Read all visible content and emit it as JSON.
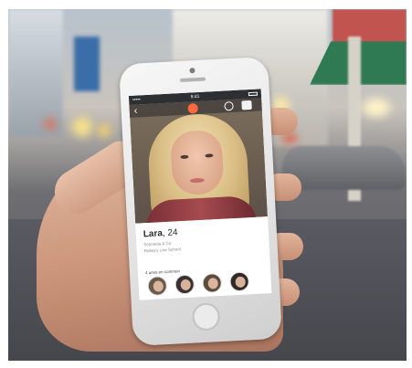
{
  "scene": {
    "description_colors": {
      "street_bg": "#4e4e55",
      "awning": "#2f7a52",
      "skin": "#e3b9a0",
      "phone_body": "#ececec"
    }
  },
  "phone": {
    "status_bar": {
      "carrier": "•••••",
      "time": "9:41"
    },
    "nav": {
      "back_icon": "chevron-left-icon",
      "center_icon": "flame-icon",
      "right_icons": [
        "chat-icon",
        "card-icon"
      ]
    },
    "profile": {
      "name": "Lara",
      "separator": ",",
      "age": "24",
      "details": [
        "Schneida & Co",
        "Ridley's Law School",
        ""
      ],
      "mutual_friends_label": "4 amis en commun",
      "mutual_friends": [
        {
          "avatar": "#6b5a4c"
        },
        {
          "avatar": "#3a3130"
        },
        {
          "avatar": "#5c4c3f"
        },
        {
          "avatar": "#2f2a28"
        }
      ]
    }
  }
}
